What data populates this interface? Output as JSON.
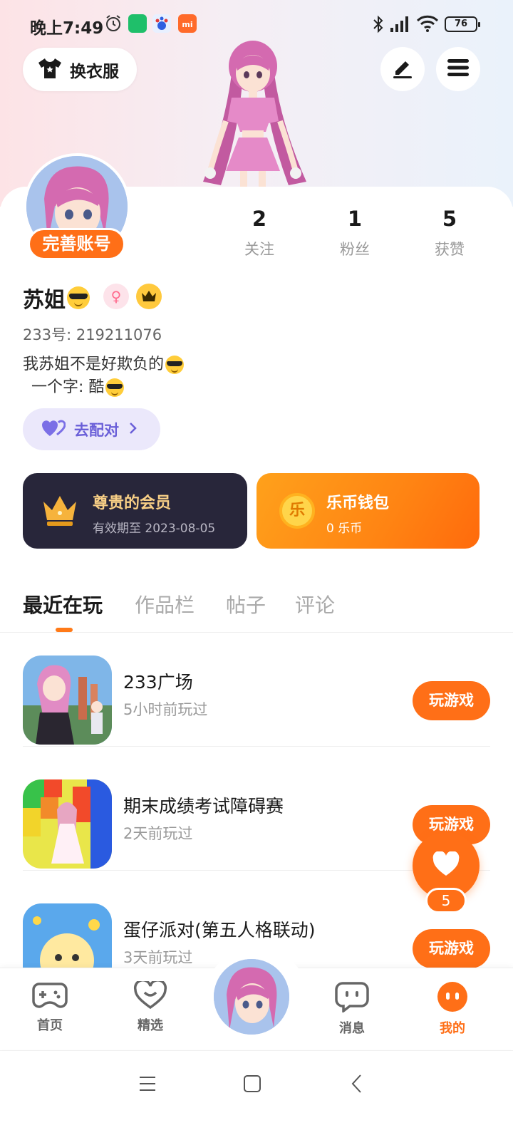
{
  "status_bar": {
    "time": "晚上7:49",
    "battery": "76"
  },
  "top": {
    "dress_up_label": "换衣服"
  },
  "profile": {
    "complete_account_label": "完善账号",
    "stats": [
      {
        "value": "2",
        "label": "关注"
      },
      {
        "value": "1",
        "label": "粉丝"
      },
      {
        "value": "5",
        "label": "获赞"
      }
    ],
    "username": "苏姐",
    "gender_symbol": "♀",
    "uid": "233号: 219211076",
    "bio_line1": "我苏姐不是好欺负的",
    "bio_line2": "一个字: 酷",
    "match_label": "去配对"
  },
  "membership": {
    "title": "尊贵的会员",
    "expiry": "有效期至 2023-08-05"
  },
  "wallet": {
    "coin_glyph": "乐",
    "title": "乐币钱包",
    "balance": "0 乐币"
  },
  "tabs": [
    {
      "label": "最近在玩",
      "active": true
    },
    {
      "label": "作品栏",
      "active": false
    },
    {
      "label": "帖子",
      "active": false
    },
    {
      "label": "评论",
      "active": false
    }
  ],
  "games": [
    {
      "name": "233广场",
      "time": "5小时前玩过",
      "action": "玩游戏"
    },
    {
      "name": "期末成绩考试障碍赛",
      "time": "2天前玩过",
      "action": "玩游戏"
    },
    {
      "name": "蛋仔派对(第五人格联动)",
      "time": "3天前玩过",
      "action": "玩游戏"
    }
  ],
  "fab": {
    "count": "5"
  },
  "bottom_nav": [
    {
      "label": "首页",
      "icon": "gamepad-icon"
    },
    {
      "label": "精选",
      "icon": "heart-outline-icon"
    },
    {
      "label": "消息",
      "icon": "chat-icon"
    },
    {
      "label": "我的",
      "icon": "profile-face-icon",
      "active": true
    }
  ],
  "colors": {
    "accent": "#ff6f17",
    "vip_bg": "#28263a",
    "vip_gold": "#f8cf86",
    "match_purple": "#6a5fd8"
  }
}
